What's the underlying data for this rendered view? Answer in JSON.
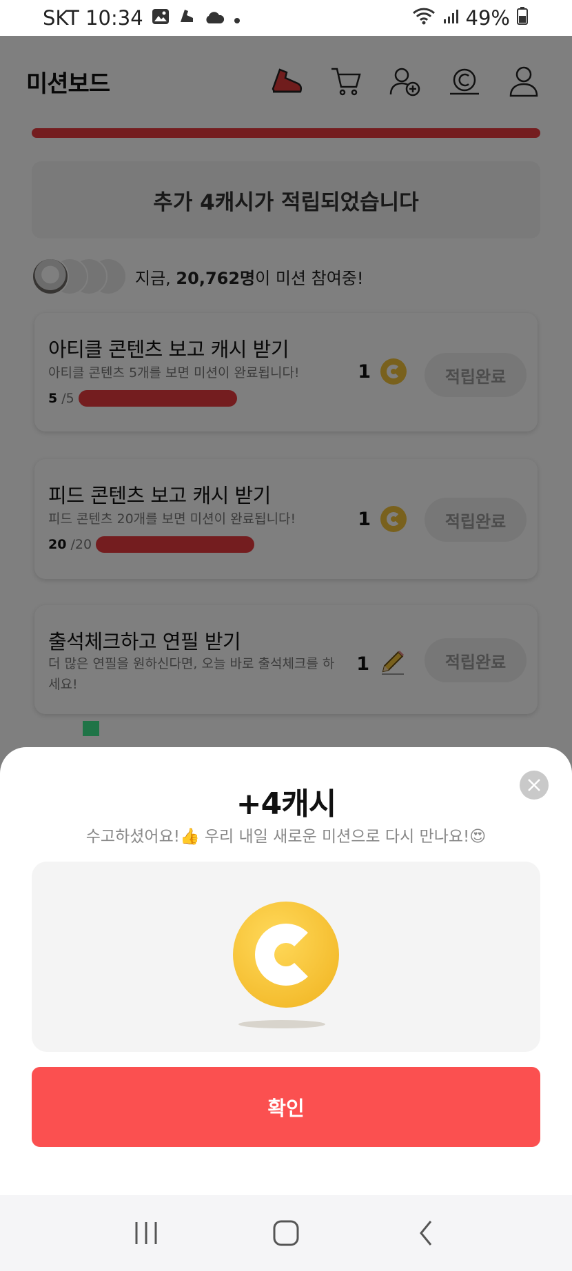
{
  "status_bar": {
    "carrier_time": "SKT 10:34",
    "battery": "49%"
  },
  "header": {
    "title": "미션보드",
    "icons": [
      "shoe-icon",
      "cart-icon",
      "add-friend-icon",
      "cash-coin-icon",
      "profile-icon"
    ]
  },
  "banner": {
    "text": "추가 4캐시가 적립되었습니다"
  },
  "participants": {
    "prefix": "지금, ",
    "count": "20,762명",
    "suffix": "이 미션 참여중!"
  },
  "missions": [
    {
      "title": "아티클 콘텐츠 보고 캐시 받기",
      "desc": "아티클 콘텐츠 5개를 보면 미션이 완료됩니다!",
      "progress_current": "5",
      "progress_total": "/5",
      "progress_fraction": 1.0,
      "reward_amount": "1",
      "reward_icon": "cash-coin-icon",
      "button": "적립완료"
    },
    {
      "title": "피드 콘텐츠 보고 캐시 받기",
      "desc": "피드 콘텐츠 20개를 보면 미션이 완료됩니다!",
      "progress_current": "20",
      "progress_total": "/20",
      "progress_fraction": 1.0,
      "reward_amount": "1",
      "reward_icon": "cash-coin-icon",
      "button": "적립완료"
    },
    {
      "title": "출석체크하고 연필 받기",
      "desc": "더 많은 연필을 원하신다면, 오늘 바로 출석체크를 하세요!",
      "reward_amount": "1",
      "reward_icon": "pencil-icon",
      "button": "적립완료"
    }
  ],
  "sheet": {
    "title": "+4캐시",
    "subtitle": "수고하셨어요!👍 우리 내일 새로운 미션으로 다시 만나요!😍",
    "confirm": "확인"
  },
  "colors": {
    "accent": "#e83a3f",
    "confirm_button": "#fb5050",
    "coin": "#f3c23b"
  }
}
